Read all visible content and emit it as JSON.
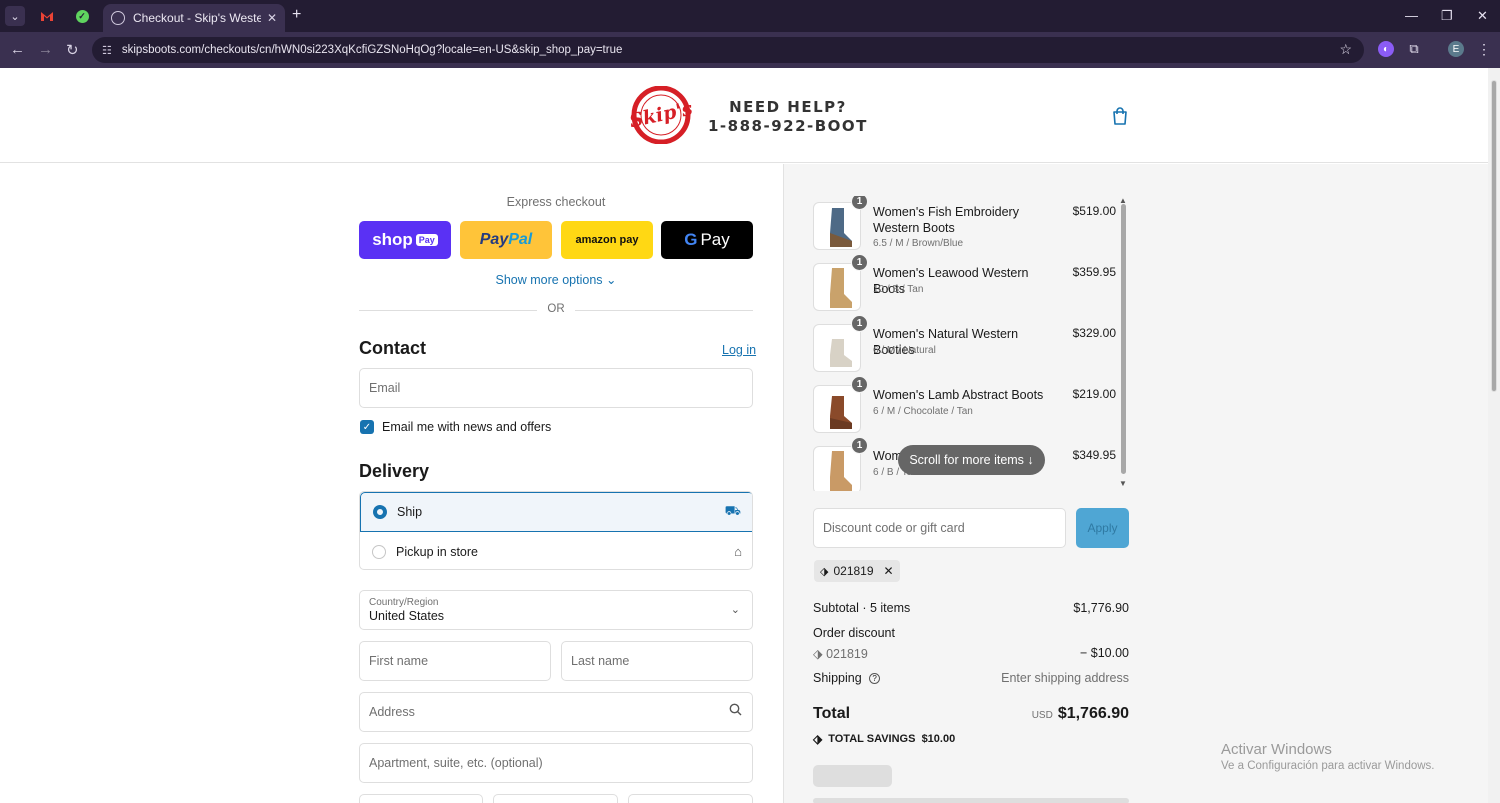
{
  "browser": {
    "tab_title": "Checkout - Skip's Western Outf",
    "url": "skipsboots.com/checkouts/cn/hWN0si223XqKcfiGZSNoHqOg?locale=en-US&skip_shop_pay=true",
    "profile_initial": "E"
  },
  "header": {
    "help_line1": "NEED HELP?",
    "help_line2": "1-888-922-BOOT"
  },
  "express": {
    "label": "Express checkout",
    "shoppay_text": "shop",
    "shoppay_badge": "Pay",
    "paypal_a": "Pay",
    "paypal_b": "Pal",
    "amazon": "amazon pay",
    "gpay_g": "G",
    "gpay_text": "Pay",
    "more_options": "Show more options ⌄",
    "or": "OR"
  },
  "contact": {
    "title": "Contact",
    "login": "Log in",
    "email_placeholder": "Email",
    "newsletter_label": "Email me with news and offers",
    "newsletter_checked": true
  },
  "delivery": {
    "title": "Delivery",
    "ship_label": "Ship",
    "pickup_label": "Pickup in store",
    "country_label": "Country/Region",
    "country_value": "United States",
    "first_name_placeholder": "First name",
    "last_name_placeholder": "Last name",
    "address_placeholder": "Address",
    "apartment_placeholder": "Apartment, suite, etc. (optional)"
  },
  "cart": {
    "items": [
      {
        "name": "Women's Fish Embroidery Western Boots",
        "variant": "6.5 / M / Brown/Blue",
        "price": "$519.00",
        "qty": "1",
        "color": "#7a5a3c",
        "shaft": "#4e6a86"
      },
      {
        "name": "Women's Leawood Western Boots",
        "variant": "10 / B / Tan",
        "price": "$359.95",
        "qty": "1",
        "color": "#c9a26b",
        "shaft": "#c9a26b"
      },
      {
        "name": "Women's Natural Western Booties",
        "variant": "6 / M / Natural",
        "price": "$329.00",
        "qty": "1",
        "color": "#d8d2c6",
        "shaft": "#d8d2c6"
      },
      {
        "name": "Women's Lamb Abstract Boots",
        "variant": "6 / M / Chocolate / Tan",
        "price": "$219.00",
        "qty": "1",
        "color": "#6b3a22",
        "shaft": "#8a4a2a"
      },
      {
        "name": "Wom",
        "variant": "6 / B / Tan",
        "price": "$349.95",
        "qty": "1",
        "color": "#b98a58",
        "shaft": "#c99a66"
      }
    ],
    "scroll_hint": "Scroll for more items ↓",
    "discount_placeholder": "Discount code or gift card",
    "apply_label": "Apply",
    "applied_code": "021819"
  },
  "summary": {
    "subtotal_label": "Subtotal · 5 items",
    "subtotal_value": "$1,776.90",
    "order_discount_label": "Order discount",
    "discount_code": "021819",
    "discount_value": "− $10.00",
    "shipping_label": "Shipping",
    "shipping_value": "Enter shipping address",
    "total_label": "Total",
    "total_currency": "USD",
    "total_value": "$1,766.90",
    "savings_label": "TOTAL SAVINGS",
    "savings_value": "$10.00"
  },
  "watermark": {
    "line1": "Activar Windows",
    "line2": "Ve a Configuración para activar Windows."
  },
  "colors": {
    "accent": "#1773b0",
    "shoppay": "#5a31f4",
    "paypal": "#ffc439",
    "amazon": "#ffd814",
    "logo_red": "#d61f26"
  }
}
